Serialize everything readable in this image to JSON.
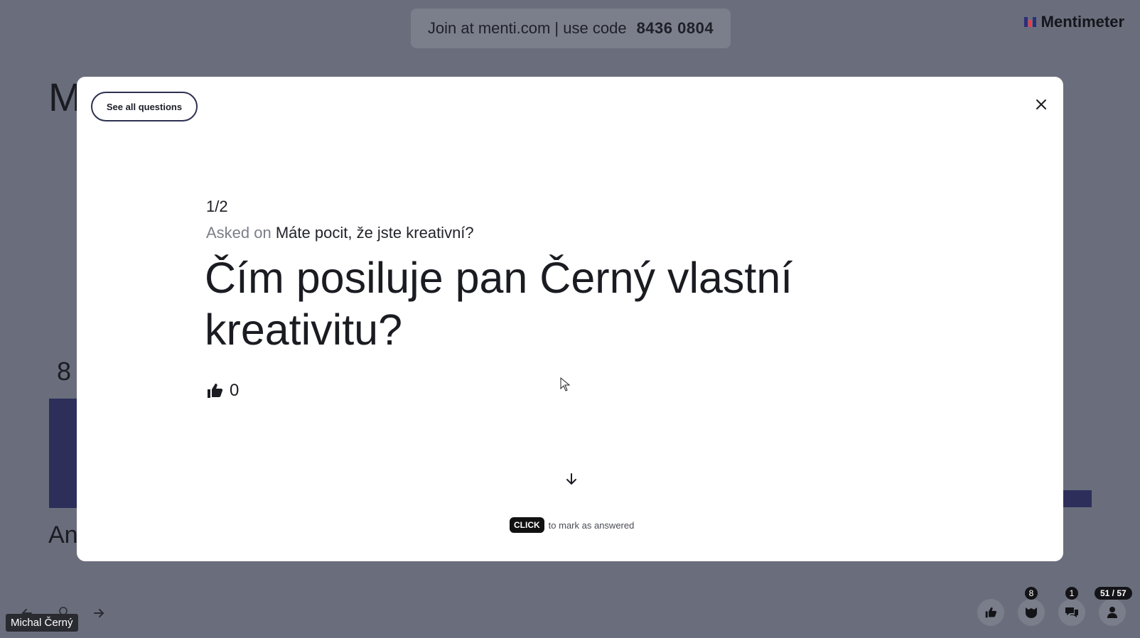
{
  "banner": {
    "join_text": "Join at menti.com | use code",
    "code": "8436 0804"
  },
  "brand": {
    "name": "Mentimeter"
  },
  "background_slide": {
    "title_fragment": "M",
    "count_fragment": "8",
    "answer_fragment": "An"
  },
  "modal": {
    "see_all_label": "See all questions",
    "counter": "1/2",
    "asked_on_prefix": "Asked on",
    "asked_on_question": "Máte pocit, že jste kreativní?",
    "question": "Čím posiluje pan Černý vlastní kreativitu?",
    "likes": "0",
    "click_badge": "CLICK",
    "click_hint": "to mark as answered"
  },
  "presenter": {
    "name": "Michal Černý"
  },
  "controls": {
    "reactions_count": "8",
    "qa_count": "1",
    "participants": "51 / 57"
  },
  "colors": {
    "overlay": "#6a6e7c",
    "modal": "#ffffff",
    "bar": "#2d2f5a"
  }
}
